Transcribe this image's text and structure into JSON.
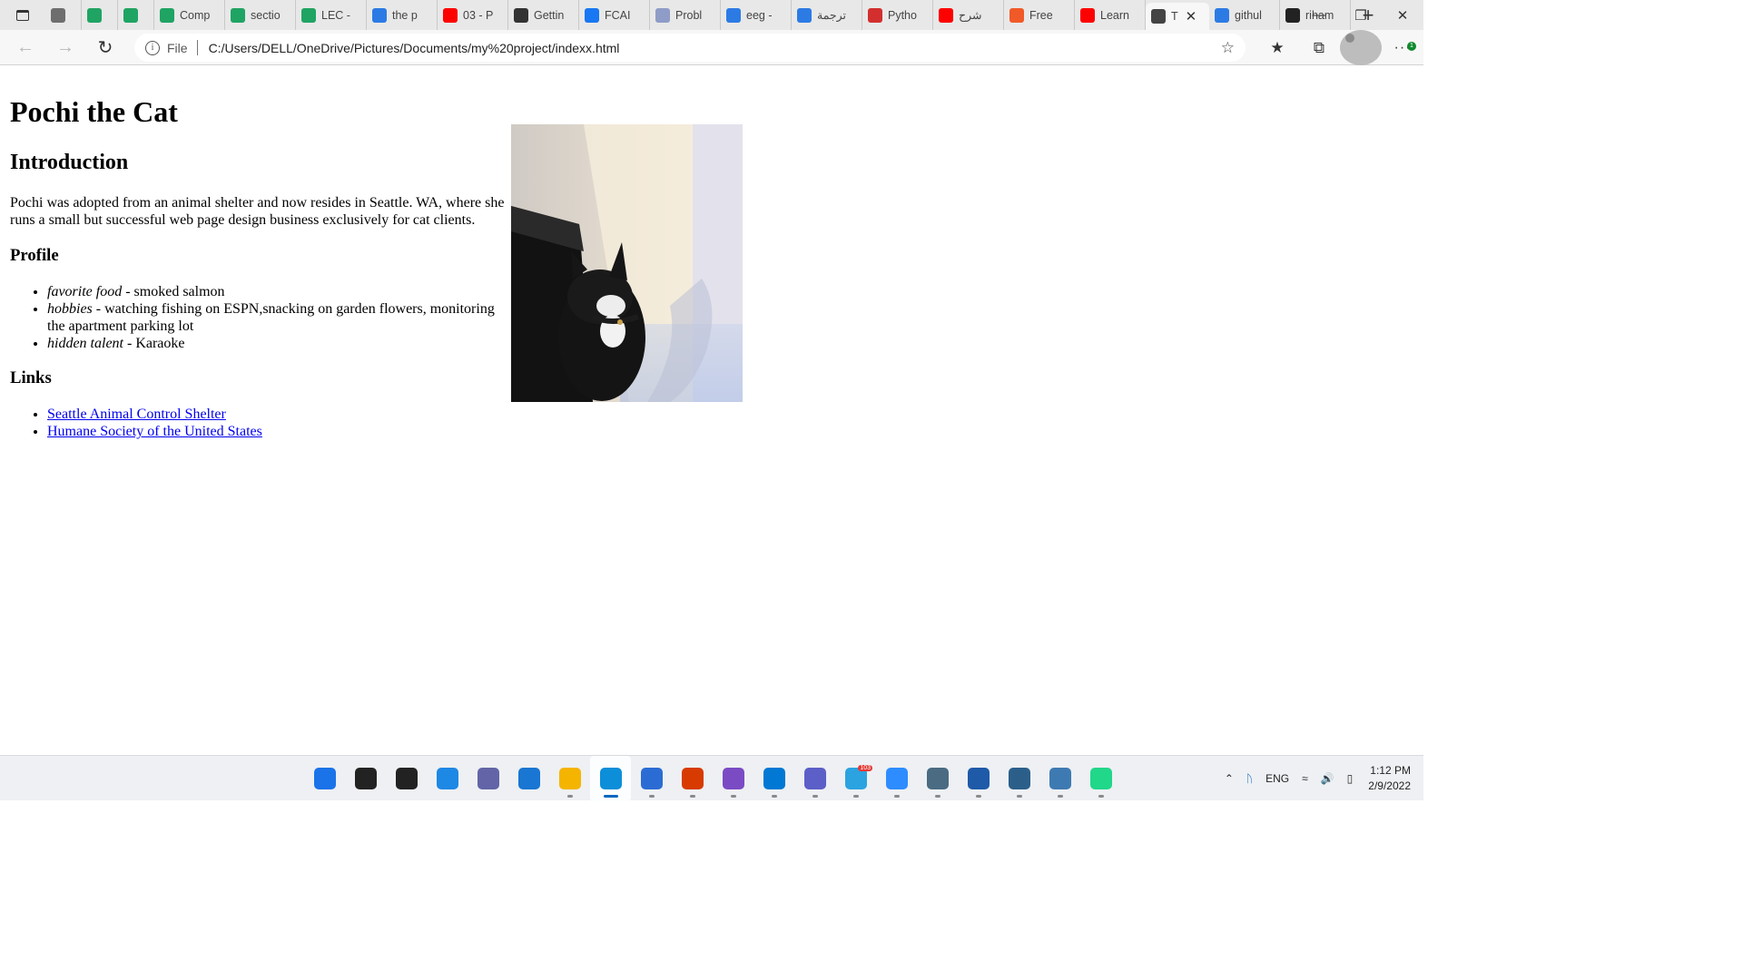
{
  "browser": {
    "tabs": [
      {
        "label": "",
        "icon": "document-icon",
        "color": "#6e6e6e"
      },
      {
        "label": "",
        "icon": "google-drive-icon",
        "color": "#1fa463"
      },
      {
        "label": "",
        "icon": "google-drive-icon",
        "color": "#1fa463"
      },
      {
        "label": "Comp",
        "icon": "google-drive-icon",
        "color": "#1fa463"
      },
      {
        "label": "sectio",
        "icon": "google-drive-icon",
        "color": "#1fa463"
      },
      {
        "label": "LEC -",
        "icon": "google-drive-icon",
        "color": "#1fa463"
      },
      {
        "label": "the p",
        "icon": "bing-icon",
        "color": "#2c7be5"
      },
      {
        "label": "03 - P",
        "icon": "youtube-icon",
        "color": "#ff0000"
      },
      {
        "label": "Gettin",
        "icon": "tpg-icon",
        "color": "#333333"
      },
      {
        "label": "FCAI",
        "icon": "facebook-icon",
        "color": "#1877f2"
      },
      {
        "label": "Probl",
        "icon": "chart-icon",
        "color": "#8e9cc7"
      },
      {
        "label": "eeg -",
        "icon": "bing-icon",
        "color": "#2c7be5"
      },
      {
        "label": "ترجمة",
        "icon": "bing-icon",
        "color": "#2c7be5"
      },
      {
        "label": "Pytho",
        "icon": "pdf-icon",
        "color": "#d32f2f"
      },
      {
        "label": "شرح",
        "icon": "youtube-icon",
        "color": "#ff0000"
      },
      {
        "label": "Free",
        "icon": "chat-icon",
        "color": "#f05a28"
      },
      {
        "label": "Learn",
        "icon": "youtube-icon",
        "color": "#ff0000"
      },
      {
        "label": "T",
        "icon": "page-icon",
        "color": "#444444",
        "active": true
      },
      {
        "label": "githul",
        "icon": "bing-icon",
        "color": "#2c7be5"
      },
      {
        "label": "riham",
        "icon": "github-icon",
        "color": "#222222"
      }
    ],
    "address": {
      "protocol": "File",
      "url": "C:/Users/DELL/OneDrive/Pictures/Documents/my%20project/indexx.html"
    },
    "menu_badge": "1"
  },
  "page": {
    "title": "Pochi the Cat",
    "intro_heading": "Introduction",
    "intro_text": "Pochi was adopted from an animal shelter and now resides in Seattle. WA, where she runs a small but successful web page design business exclusively for cat clients.",
    "profile_heading": "Profile",
    "profile": [
      {
        "label": "favorite food",
        "value": " - smoked salmon"
      },
      {
        "label": "hobbies",
        "value": " - watching fishing on ESPN,snacking on garden flowers, monitoring the apartment parking lot"
      },
      {
        "label": "hidden talent",
        "value": " - Karaoke"
      }
    ],
    "links_heading": "Links",
    "links": [
      "Seattle Animal Control Shelter",
      "Humane Society of the United States"
    ]
  },
  "taskbar": {
    "apps": [
      {
        "name": "windows-start-icon",
        "color": "#1a73e8"
      },
      {
        "name": "search-icon",
        "color": "#222222"
      },
      {
        "name": "task-view-icon",
        "color": "#222222"
      },
      {
        "name": "widgets-icon",
        "color": "#1e88e5"
      },
      {
        "name": "teams-chat-icon",
        "color": "#6264a7"
      },
      {
        "name": "mail-icon",
        "color": "#1976d2"
      },
      {
        "name": "file-explorer-icon",
        "color": "#f4b400"
      },
      {
        "name": "edge-icon",
        "color": "#0c8ed9",
        "active": true
      },
      {
        "name": "microsoft-store-icon",
        "color": "#2b6cd4"
      },
      {
        "name": "office-icon",
        "color": "#d83b01"
      },
      {
        "name": "visual-studio-icon",
        "color": "#7b4bc4"
      },
      {
        "name": "vscode-icon",
        "color": "#0078d4"
      },
      {
        "name": "teams-icon",
        "color": "#5b5fc7"
      },
      {
        "name": "telegram-icon",
        "color": "#2aa3e0",
        "badge": "103"
      },
      {
        "name": "zoom-icon",
        "color": "#2d8cff"
      },
      {
        "name": "anaconda-icon",
        "color": "#4a6b82"
      },
      {
        "name": "virtualbox-icon",
        "color": "#1e5aa8"
      },
      {
        "name": "mysql-workbench-icon",
        "color": "#2b5f8a"
      },
      {
        "name": "python-installer-icon",
        "color": "#3e7ab2"
      },
      {
        "name": "pycharm-icon",
        "color": "#21d789"
      }
    ],
    "tray": {
      "language": "ENG",
      "time": "1:12 PM",
      "date": "2/9/2022"
    }
  }
}
